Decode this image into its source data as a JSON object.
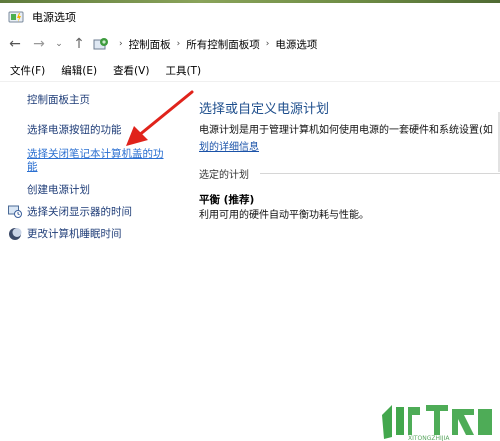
{
  "window": {
    "title": "电源选项"
  },
  "nav": {
    "back_glyph": "←",
    "forward_glyph": "→",
    "dropdown_glyph": "⌄",
    "up_glyph": "↑",
    "breadcrumb": [
      "控制面板",
      "所有控制面板项",
      "电源选项"
    ],
    "separator": "›"
  },
  "menu": [
    "文件(F)",
    "编辑(E)",
    "查看(V)",
    "工具(T)"
  ],
  "sidebar": {
    "home": "控制面板主页",
    "power_buttons": "选择电源按钮的功能",
    "lid_line1": "选择关闭笔记本计算机盖的功",
    "lid_line2": "能",
    "create_plan": "创建电源计划",
    "display_off": "选择关闭显示器的时间",
    "sleep": "更改计算机睡眠时间"
  },
  "main": {
    "title": "选择或自定义电源计划",
    "description": "电源计划是用于管理计算机如何使用电源的一套硬件和系统设置(如",
    "description_link": "划的详细信息",
    "section_label": "选定的计划",
    "plan_name": "平衡 (推荐)",
    "plan_description": "利用可用的硬件自动平衡功耗与性能。"
  },
  "colors": {
    "link": "#1a52a8",
    "title_blue": "#1e4e8c",
    "annotation_red": "#e0231b",
    "watermark_green": "#2f9d3a"
  },
  "icons": {
    "title": "power-options-icon",
    "control_panel": "control-panel-icon",
    "display": "display-clock-icon",
    "sleep": "moon-icon"
  }
}
